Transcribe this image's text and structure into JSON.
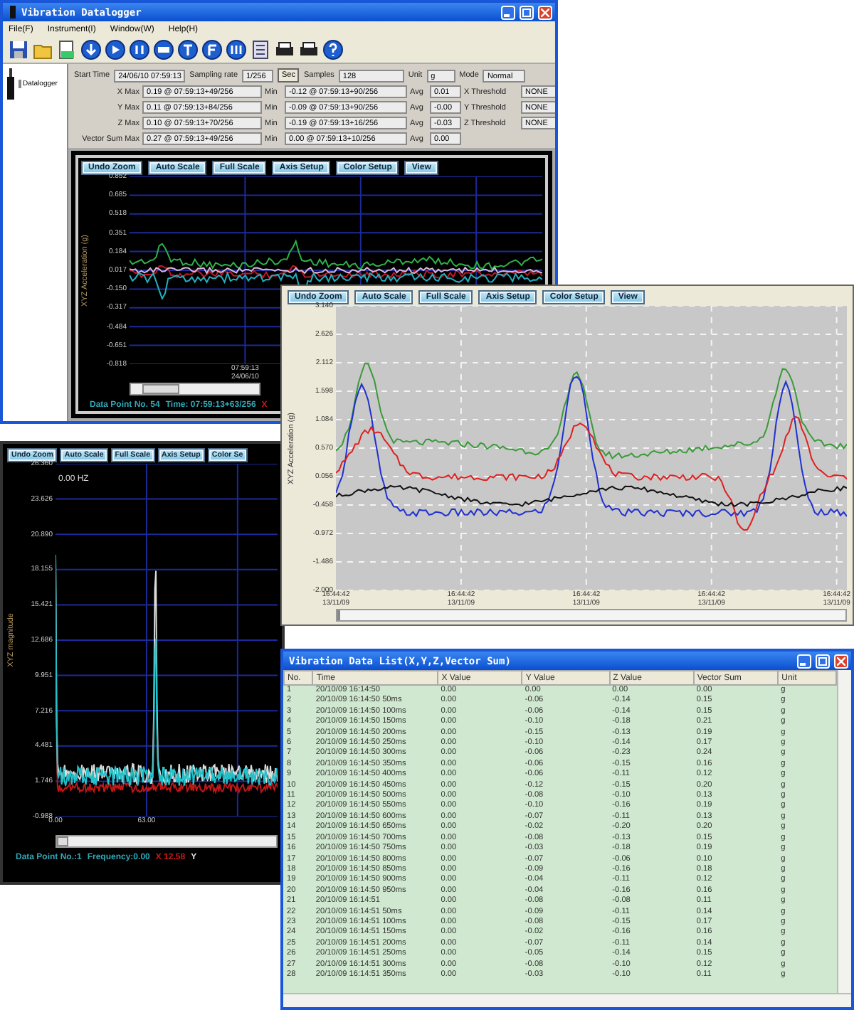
{
  "main_window": {
    "title": "Vibration Datalogger",
    "menu": [
      "File(F)",
      "Instrument(I)",
      "Window(W)",
      "Help(H)"
    ],
    "tree": [
      {
        "label": "Datalogger"
      }
    ],
    "summary": {
      "start_time_label": "Start Time",
      "start_time": "24/06/10 07:59:13",
      "sampling_rate_label": "Sampling rate",
      "sampling_rate": "1/256",
      "sampling_unit": "Sec",
      "samples_label": "Samples",
      "samples": "128",
      "unit_label": "Unit",
      "unit": "g",
      "mode_label": "Mode",
      "mode": "Normal"
    },
    "axes": [
      {
        "label": "X  Max",
        "max": "0.19 @ 07:59:13+49/256",
        "min_label": "Min",
        "min": "-0.12 @ 07:59:13+90/256",
        "avg_label": "Avg",
        "avg": "0.01",
        "threshold_label": "X Threshold",
        "threshold": "NONE"
      },
      {
        "label": "Y  Max",
        "max": "0.11 @ 07:59:13+84/256",
        "min_label": "Min",
        "min": "-0.09 @ 07:59:13+90/256",
        "avg_label": "Avg",
        "avg": "-0.00",
        "threshold_label": "Y Threshold",
        "threshold": "NONE"
      },
      {
        "label": "Z  Max",
        "max": "0.10 @ 07:59:13+70/256",
        "min_label": "Min",
        "min": "-0.19 @ 07:59:13+16/256",
        "avg_label": "Avg",
        "avg": "-0.03",
        "threshold_label": "Z Threshold",
        "threshold": "NONE"
      },
      {
        "label": "Vector Sum Max",
        "max": "0.27 @ 07:59:13+49/256",
        "min_label": "Min",
        "min": "0.00 @ 07:59:13+10/256",
        "avg_label": "Avg",
        "avg": "0.00"
      }
    ],
    "chart": {
      "kind": "dark",
      "buttons": [
        "Undo Zoom",
        "Auto Scale",
        "Full Scale",
        "Axis Setup",
        "Color Setup",
        "View"
      ],
      "y_axis_label": "XYZ Acceleration (g)",
      "y_ticks": [
        "0.852",
        "0.685",
        "0.518",
        "0.351",
        "0.184",
        "0.017",
        "-0.150",
        "-0.317",
        "-0.484",
        "-0.651",
        "-0.818"
      ],
      "x_ticks": [
        {
          "label": "07:59:13",
          "sub": "24/06/10"
        }
      ],
      "status": [
        {
          "text": "Data Point No. 54",
          "color": "#2fa8b8"
        },
        {
          "text": "Time: 07:59:13+63/256",
          "color": "#2fa8b8"
        },
        {
          "text": "X",
          "color": "#d01818"
        }
      ]
    }
  },
  "acceleration_window": {
    "chart": {
      "kind": "light",
      "buttons": [
        "Undo Zoom",
        "Auto Scale",
        "Full Scale",
        "Axis Setup",
        "Color Setup",
        "View"
      ],
      "y_axis_label": "XYZ Acceleration (g)",
      "y_ticks": [
        "3.140",
        "2.626",
        "2.112",
        "1.598",
        "1.084",
        "0.570",
        "0.056",
        "-0.458",
        "-0.972",
        "-1.486",
        "-2.000"
      ],
      "x_ticks": [
        {
          "label": "16:44:42",
          "sub": "13/11/09"
        },
        {
          "label": "16:44:42",
          "sub": "13/11/09"
        },
        {
          "label": "16:44:42",
          "sub": "13/11/09"
        },
        {
          "label": "16:44:42",
          "sub": "13/11/09"
        },
        {
          "label": "16:44:42",
          "sub": "13/11/09"
        }
      ]
    }
  },
  "spectrum_window": {
    "chart": {
      "kind": "dark",
      "buttons": [
        "Undo Zoom",
        "Auto Scale",
        "Full Scale",
        "Axis Setup",
        "Color Se"
      ],
      "y_axis_label": "XYZ magnitude",
      "readout": "0.00 HZ",
      "y_ticks": [
        "26.360",
        "23.626",
        "20.890",
        "18.155",
        "15.421",
        "12.686",
        "9.951",
        "7.216",
        "4.481",
        "1.746",
        "-0.988"
      ],
      "x_ticks": [
        {
          "label": "0.00"
        },
        {
          "label": "63.00"
        }
      ],
      "status": [
        {
          "text": "Data Point No.:1",
          "color": "#2fa8b8"
        },
        {
          "text": "Frequency:0.00",
          "color": "#2fa8b8"
        },
        {
          "text": "X 12.58",
          "color": "#d01818"
        },
        {
          "text": "Y",
          "color": "#e0e0e0"
        }
      ]
    }
  },
  "data_list": {
    "title": "Vibration Data List(X,Y,Z,Vector Sum)",
    "columns": [
      "No.",
      "Time",
      "X Value",
      "Y Value",
      "Z Value",
      "Vector Sum",
      "Unit"
    ],
    "rows": [
      [
        "1",
        "20/10/09 16:14:50",
        "0.00",
        "0.00",
        "0.00",
        "0.00",
        "g"
      ],
      [
        "2",
        "20/10/09 16:14:50 50ms",
        "0.00",
        "-0.06",
        "-0.14",
        "0.15",
        "g"
      ],
      [
        "3",
        "20/10/09 16:14:50 100ms",
        "0.00",
        "-0.06",
        "-0.14",
        "0.15",
        "g"
      ],
      [
        "4",
        "20/10/09 16:14:50 150ms",
        "0.00",
        "-0.10",
        "-0.18",
        "0.21",
        "g"
      ],
      [
        "5",
        "20/10/09 16:14:50 200ms",
        "0.00",
        "-0.15",
        "-0.13",
        "0.19",
        "g"
      ],
      [
        "6",
        "20/10/09 16:14:50 250ms",
        "0.00",
        "-0.10",
        "-0.14",
        "0.17",
        "g"
      ],
      [
        "7",
        "20/10/09 16:14:50 300ms",
        "0.00",
        "-0.06",
        "-0.23",
        "0.24",
        "g"
      ],
      [
        "8",
        "20/10/09 16:14:50 350ms",
        "0.00",
        "-0.06",
        "-0.15",
        "0.16",
        "g"
      ],
      [
        "9",
        "20/10/09 16:14:50 400ms",
        "0.00",
        "-0.06",
        "-0.11",
        "0.12",
        "g"
      ],
      [
        "10",
        "20/10/09 16:14:50 450ms",
        "0.00",
        "-0.12",
        "-0.15",
        "0.20",
        "g"
      ],
      [
        "11",
        "20/10/09 16:14:50 500ms",
        "0.00",
        "-0.08",
        "-0.10",
        "0.13",
        "g"
      ],
      [
        "12",
        "20/10/09 16:14:50 550ms",
        "0.00",
        "-0.10",
        "-0.16",
        "0.19",
        "g"
      ],
      [
        "13",
        "20/10/09 16:14:50 600ms",
        "0.00",
        "-0.07",
        "-0.11",
        "0.13",
        "g"
      ],
      [
        "14",
        "20/10/09 16:14:50 650ms",
        "0.00",
        "-0.02",
        "-0.20",
        "0.20",
        "g"
      ],
      [
        "15",
        "20/10/09 16:14:50 700ms",
        "0.00",
        "-0.08",
        "-0.13",
        "0.15",
        "g"
      ],
      [
        "16",
        "20/10/09 16:14:50 750ms",
        "0.00",
        "-0.03",
        "-0.18",
        "0.19",
        "g"
      ],
      [
        "17",
        "20/10/09 16:14:50 800ms",
        "0.00",
        "-0.07",
        "-0.06",
        "0.10",
        "g"
      ],
      [
        "18",
        "20/10/09 16:14:50 850ms",
        "0.00",
        "-0.09",
        "-0.16",
        "0.18",
        "g"
      ],
      [
        "19",
        "20/10/09 16:14:50 900ms",
        "0.00",
        "-0.04",
        "-0.11",
        "0.12",
        "g"
      ],
      [
        "20",
        "20/10/09 16:14:50 950ms",
        "0.00",
        "-0.04",
        "-0.16",
        "0.16",
        "g"
      ],
      [
        "21",
        "20/10/09 16:14:51",
        "0.00",
        "-0.08",
        "-0.08",
        "0.11",
        "g"
      ],
      [
        "22",
        "20/10/09 16:14:51 50ms",
        "0.00",
        "-0.09",
        "-0.11",
        "0.14",
        "g"
      ],
      [
        "23",
        "20/10/09 16:14:51 100ms",
        "0.00",
        "-0.08",
        "-0.15",
        "0.17",
        "g"
      ],
      [
        "24",
        "20/10/09 16:14:51 150ms",
        "0.00",
        "-0.02",
        "-0.16",
        "0.16",
        "g"
      ],
      [
        "25",
        "20/10/09 16:14:51 200ms",
        "0.00",
        "-0.07",
        "-0.11",
        "0.14",
        "g"
      ],
      [
        "26",
        "20/10/09 16:14:51 250ms",
        "0.00",
        "-0.05",
        "-0.14",
        "0.15",
        "g"
      ],
      [
        "27",
        "20/10/09 16:14:51 300ms",
        "0.00",
        "-0.08",
        "-0.10",
        "0.12",
        "g"
      ],
      [
        "28",
        "20/10/09 16:14:51 350ms",
        "0.00",
        "-0.03",
        "-0.10",
        "0.11",
        "g"
      ]
    ]
  }
}
